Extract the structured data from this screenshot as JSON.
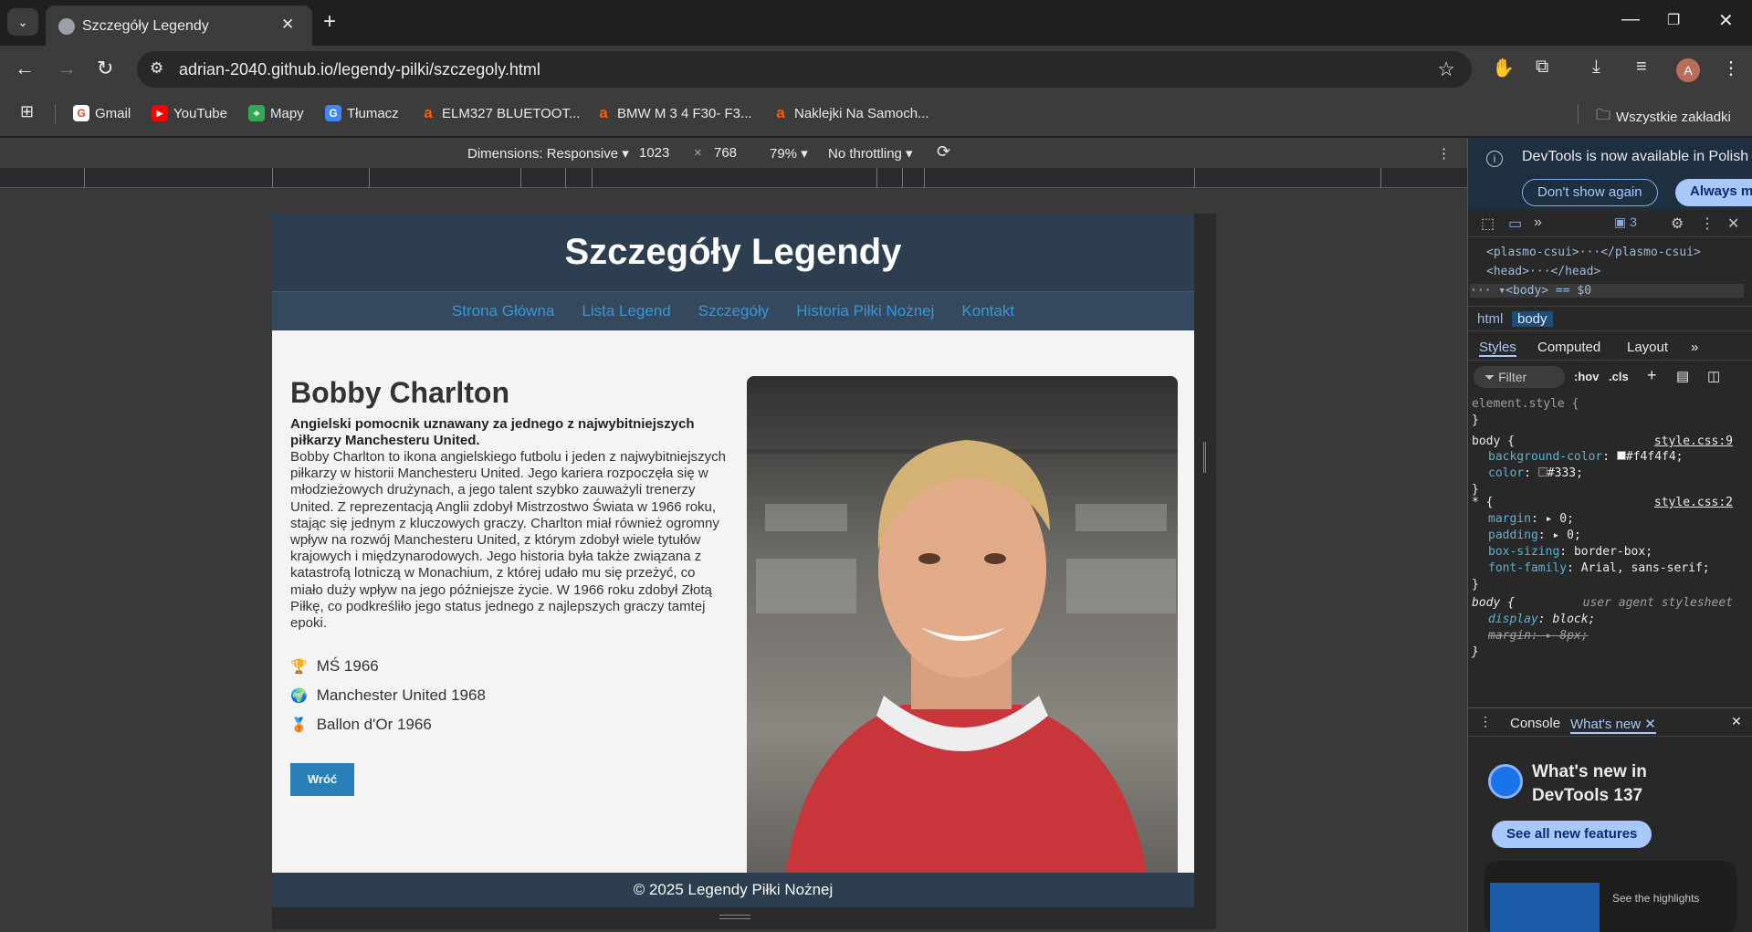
{
  "browser": {
    "tab_title": "Szczegóły Legendy",
    "url": "adrian-2040.github.io/legendy-pilki/szczegoly.html",
    "bookmarks": [
      {
        "label": "Gmail",
        "icon": "gmail-icon",
        "color": "#ea4335"
      },
      {
        "label": "YouTube",
        "icon": "youtube-icon",
        "color": "#ff0000"
      },
      {
        "label": "Mapy",
        "icon": "maps-icon",
        "color": "#34a853"
      },
      {
        "label": "Tłumacz",
        "icon": "translate-icon",
        "color": "#4285f4"
      },
      {
        "label": "ELM327 BLUETOOT...",
        "icon": "allegro-icon",
        "color": "#ff5a00"
      },
      {
        "label": "BMW M 3 4 F30- F3...",
        "icon": "allegro-icon",
        "color": "#ff5a00"
      },
      {
        "label": "Naklejki Na Samoch...",
        "icon": "allegro-icon",
        "color": "#ff5a00"
      }
    ],
    "all_bookmarks": "Wszystkie zakładki",
    "profile_initial": "A"
  },
  "device_toolbar": {
    "dimensions": "Dimensions: Responsive",
    "width": "1023",
    "times": "×",
    "height": "768",
    "zoom": "79%",
    "throttling": "No throttling"
  },
  "page": {
    "title": "Szczegóły Legendy",
    "nav": [
      "Strona Główna",
      "Lista Legend",
      "Szczegóły",
      "Historia Piłki Nożnej",
      "Kontakt"
    ],
    "player_name": "Bobby Charlton",
    "lead": "Angielski pomocnik uznawany za jednego z najwybitniejszych piłkarzy Manchesteru United.",
    "bio": "Bobby Charlton to ikona angielskiego futbolu i jeden z najwybitniejszych piłkarzy w historii Manchesteru United. Jego kariera rozpoczęła się w młodzieżowych drużynach, a jego talent szybko zauważyli trenerzy United. Z reprezentacją Anglii zdobył Mistrzostwo Świata w 1966 roku, stając się jednym z kluczowych graczy. Charlton miał również ogromny wpływ na rozwój Manchesteru United, z którym zdobył wiele tytułów krajowych i międzynarodowych. Jego historia była także związana z katastrofą lotniczą w Monachium, z której udało mu się przeżyć, co miało duży wpływ na jego późniejsze życie. W 1966 roku zdobył Złotą Piłkę, co podkreśliło jego status jednego z najlepszych graczy tamtej epoki.",
    "achievements": [
      {
        "icon": "trophy-icon",
        "glyph": "🏆",
        "label": "MŚ 1966"
      },
      {
        "icon": "globe-icon",
        "glyph": "🌍",
        "label": "Manchester United 1968"
      },
      {
        "icon": "medal-icon",
        "glyph": "🥉",
        "label": "Ballon d'Or 1966"
      }
    ],
    "back_button": "Wróć",
    "footer": "© 2025 Legendy Piłki Nożnej"
  },
  "devtools": {
    "banner_text": "DevTools is now available in Polish",
    "dont_show": "Don't show again",
    "always_match": "Always mat",
    "issues_count": "3",
    "dom": {
      "line1": "<plasmo-csui>···</plasmo-csui>",
      "line2": "<head>···</head>",
      "line3": "<body> == $0"
    },
    "crumbs": [
      "html",
      "body"
    ],
    "style_tabs": [
      "Styles",
      "Computed",
      "Layout"
    ],
    "filter_placeholder": "Filter",
    "hov": ":hov",
    "cls": ".cls",
    "rules": {
      "element_style": "element.style {",
      "close": "}",
      "body1_selector": "body {",
      "body1_src": "style.css:9",
      "bg_prop": "background-color",
      "bg_val": "#f4f4f4;",
      "color_prop": "color",
      "color_val": "#333;",
      "star_selector": "* {",
      "star_src": "style.css:2",
      "margin_prop": "margin",
      "margin_val": "0;",
      "padding_prop": "padding",
      "padding_val": "0;",
      "boxsizing_prop": "box-sizing",
      "boxsizing_val": "border-box;",
      "font_prop": "font-family",
      "font_val": "Arial, sans-serif;",
      "ua_selector": "body {",
      "ua_src": "user agent stylesheet",
      "display_prop": "display",
      "display_val": "block;",
      "ua_margin_prop": "margin",
      "ua_margin_val": "8px;"
    },
    "drawer_tabs": [
      "Console",
      "What's new"
    ],
    "whatsnew_title": "What's new in DevTools 137",
    "see_all": "See all new features",
    "see_highlights": "See the highlights"
  }
}
